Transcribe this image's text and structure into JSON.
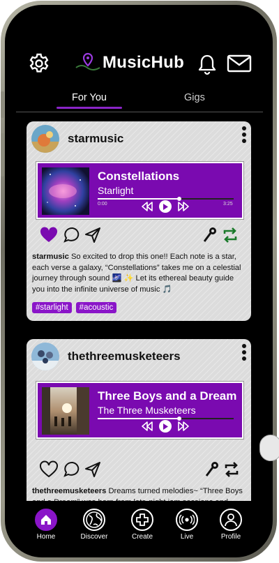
{
  "app": {
    "name": "MusicHub"
  },
  "tabs": [
    {
      "label": "For You",
      "active": true
    },
    {
      "label": "Gigs",
      "active": false
    }
  ],
  "posts": [
    {
      "username": "starmusic",
      "track_title": "Constellations",
      "artist": "Starlight",
      "time_current": "0:00",
      "time_total": "3:25",
      "progress": 0.6,
      "liked": true,
      "caption_user": "starmusic",
      "caption_text": "So excited to drop this one!! Each note is a star, each verse a galaxy, “Constellations” takes me on a celestial journey through sound 🌌 ✨ Let its ethereal beauty guide you into the infinite universe of music 🎵",
      "tags": [
        "#starlight",
        "#acoustic"
      ]
    },
    {
      "username": "thethreemusketeers",
      "track_title": "Three Boys and a Dream",
      "artist": "The Three Musketeers",
      "time_current": "",
      "time_total": "",
      "progress": 0.6,
      "liked": false,
      "caption_user": "thethreemusketeers",
      "caption_text": "Dreams turned melodies~ “Three Boys and a Dream” was born from late-night jam sessions and boundless imagination 🎸 Letting the echoes of our",
      "tags": []
    }
  ],
  "nav": [
    {
      "label": "Home",
      "icon": "home-icon",
      "active": true
    },
    {
      "label": "Discover",
      "icon": "globe-icon",
      "active": false
    },
    {
      "label": "Create",
      "icon": "plus-icon",
      "active": false
    },
    {
      "label": "Live",
      "icon": "broadcast-icon",
      "active": false
    },
    {
      "label": "Profile",
      "icon": "person-icon",
      "active": false
    }
  ],
  "colors": {
    "accent": "#8a15c8",
    "player_bg": "#7a0ab0",
    "repost": "#1a7a2a"
  }
}
